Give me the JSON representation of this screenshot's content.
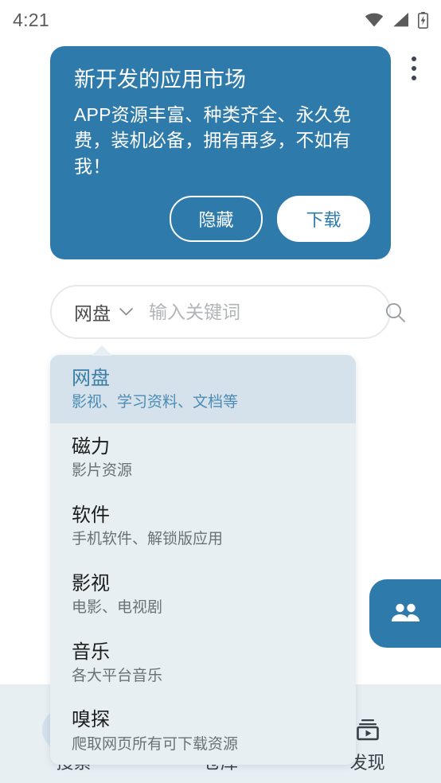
{
  "status_bar": {
    "time": "4:21",
    "icons": [
      "wifi-icon",
      "cellular-signal-icon",
      "battery-charging-icon"
    ]
  },
  "overflow": {
    "icon": "more-vertical-icon"
  },
  "banner": {
    "title": "新开发的应用市场",
    "description": "APP资源丰富、种类齐全、永久免费，装机必备，拥有再多，不如有我！",
    "hide_label": "隐藏",
    "download_label": "下载",
    "background_color": "#2e7bab"
  },
  "search": {
    "category": "网盘",
    "chevron_icon": "chevron-down-icon",
    "placeholder": "输入关键词",
    "value": "",
    "search_icon": "search-icon"
  },
  "dropdown": {
    "items": [
      {
        "name": "网盘",
        "desc": "影视、学习资料、文档等",
        "selected": true
      },
      {
        "name": "磁力",
        "desc": "影片资源",
        "selected": false
      },
      {
        "name": "软件",
        "desc": "手机软件、解锁版应用",
        "selected": false
      },
      {
        "name": "影视",
        "desc": "电影、电视剧",
        "selected": false
      },
      {
        "name": "音乐",
        "desc": "各大平台音乐",
        "selected": false
      },
      {
        "name": "嗅探",
        "desc": "爬取网页所有可下载资源",
        "selected": false
      }
    ],
    "highlight_color": "#d5e2eb",
    "highlight_text_color": "#3b7ea8"
  },
  "fab": {
    "icon": "people-group-icon",
    "color": "#2e7bab"
  },
  "bottom_nav": {
    "items": [
      {
        "label": "搜索",
        "icon": "search-icon",
        "selected": true
      },
      {
        "label": "仓库",
        "icon": "warehouse-icon",
        "selected": false
      },
      {
        "label": "发现",
        "icon": "subscriptions-video-icon",
        "selected": false
      }
    ]
  }
}
